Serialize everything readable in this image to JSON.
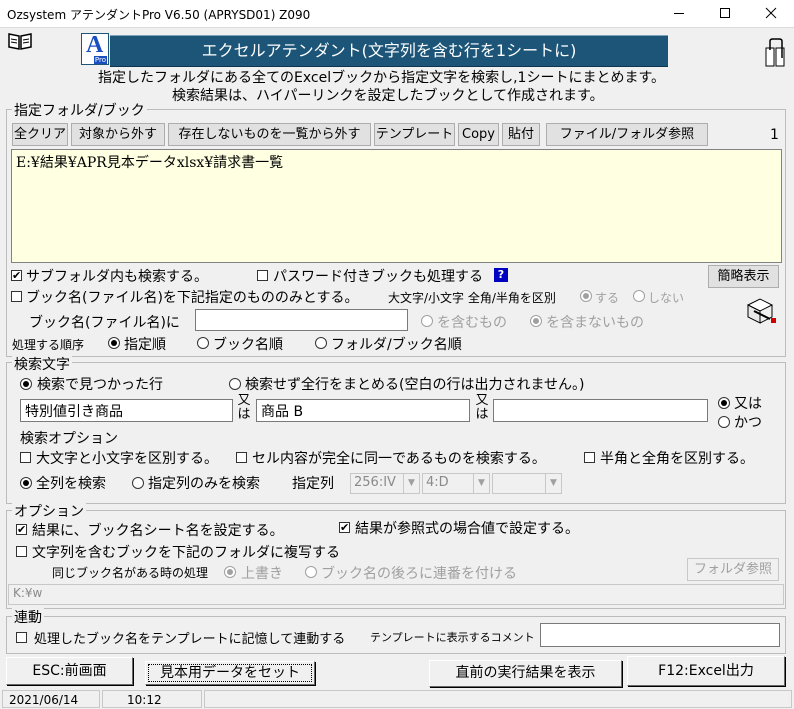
{
  "window": {
    "title": "Ozsystem アテンダントPro V6.50 (APRYSD01)  Z090"
  },
  "icons": {
    "book": "book-icon",
    "clip": "paperclip-icon",
    "logo": "ap-logo-icon",
    "export": "export-icon"
  },
  "logo": {
    "letter": "A",
    "sub": "Pro"
  },
  "banner": {
    "title": "エクセルアテンダント(文字列を含む行を1シートに)"
  },
  "description": {
    "line1": "指定したフォルダにある全てのExcelブックから指定文字を検索し,1シートにまとめます。",
    "line2": "検索結果は、ハイパーリンクを設定したブックとして作成されます。"
  },
  "folder_group": {
    "legend": "指定フォルダ/ブック",
    "buttons": [
      "全クリア",
      "対象から外す",
      "存在しないものを一覧から外す",
      "テンプレート",
      "Copy",
      "貼付",
      "ファイル/フォルダ参照"
    ],
    "count": "1",
    "list_items": [
      "E:¥結果¥APR見本データxlsx¥請求書一覧"
    ],
    "subfolder_label": "サブフォルダ内も検索する。",
    "subfolder_checked": true,
    "password_label": "パスワード付きブックも処理する",
    "password_checked": false,
    "help": "?",
    "simple_button": "簡略表示",
    "bookname_filter_label": "ブック名(ファイル名)を下記指定のもののみとする。",
    "bookname_filter_checked": false,
    "case_label": "大文字/小文字 全角/半角を区別",
    "case_opt1": "する",
    "case_opt2": "しない",
    "bookname_label": "ブック名(ファイル名)に",
    "bookname_value": "",
    "contains_opt1": "を含むもの",
    "contains_opt2": "を含まないもの",
    "order_label": "処理する順序",
    "order_opts": [
      "指定順",
      "ブック名順",
      "フォルダ/ブック名順"
    ]
  },
  "search_group": {
    "legend": "検索文字",
    "mode_opt1": "検索で見つかった行",
    "mode_opt2": "検索せず全行をまとめる(空白の行は出力されません。)",
    "term1": "特別値引き商品",
    "or1": "又は",
    "term2": "商品 B",
    "or2": "又は",
    "term3": "",
    "logic_or": "又は",
    "logic_and": "かつ",
    "options_label": "検索オプション",
    "opt_case": "大文字と小文字を区別する。",
    "opt_exact": "セル内容が完全に同一であるものを検索する。",
    "opt_width": "半角と全角を区別する。",
    "col_all": "全列を検索",
    "col_specified": "指定列のみを検索",
    "col_label": "指定列",
    "col_range": "256:IV",
    "col_from": "4:D",
    "col_to": ""
  },
  "option_group": {
    "legend": "オプション",
    "set_sheet_name": "結果に、ブック名シート名を設定する。",
    "set_sheet_name_checked": true,
    "ref_value": "結果が参照式の場合値で設定する。",
    "ref_value_checked": true,
    "copy_books": "文字列を含むブックを下記のフォルダに複写する",
    "copy_books_checked": false,
    "same_name_label": "同じブック名がある時の処理",
    "overwrite": "上書き",
    "serial": "ブック名の後ろに連番を付ける",
    "folder_ref": "フォルダ参照",
    "copy_path": "K:¥w"
  },
  "link_group": {
    "legend": "連動",
    "remember": "処理したブック名をテンプレートに記憶して連動する",
    "comment_label": "テンプレートに表示するコメント",
    "comment_value": ""
  },
  "footer": {
    "esc": "ESC:前画面",
    "sample": "見本用データをセット",
    "last_result": "直前の実行結果を表示",
    "f12": "F12:Excel出力"
  },
  "status": {
    "date": "2021/06/14",
    "time": "10:12"
  },
  "colors": {
    "banner": "#1c5578",
    "list_bg": "#ffffe1",
    "help_bg": "#0000c0"
  }
}
